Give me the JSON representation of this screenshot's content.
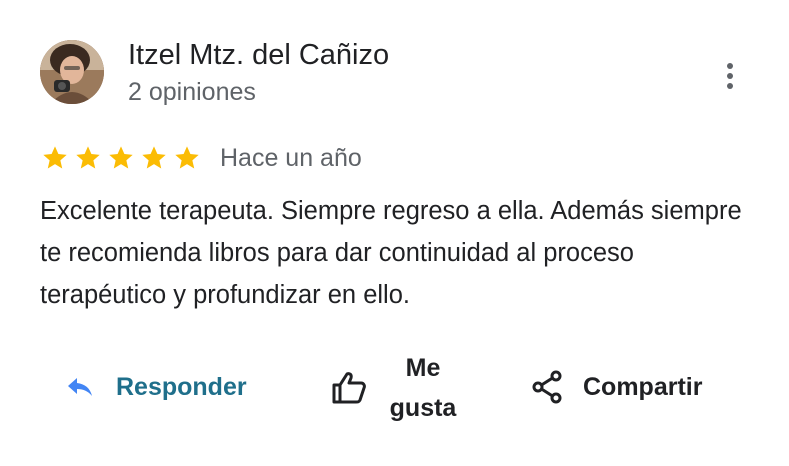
{
  "review": {
    "author_name": "Itzel Mtz. del Cañizo",
    "author_meta": "2 opiniones",
    "rating": 5,
    "rating_max": 5,
    "date": "Hace un año",
    "text": "Excelente terapeuta. Siempre regreso a ella. Además siempre te recomienda libros para dar continuidad al proceso terapéutico y profundizar en ello.",
    "star_color": "#fbbc04"
  },
  "actions": {
    "reply_label": "Responder",
    "like_label": "Me gusta",
    "share_label": "Compartir",
    "reply_color": "#1f6f8b",
    "reply_icon_color": "#4285f4"
  },
  "icons": {
    "more": "more-vert-icon",
    "reply": "reply-arrow-icon",
    "like": "thumb-up-icon",
    "share": "share-icon",
    "star": "star-icon"
  }
}
